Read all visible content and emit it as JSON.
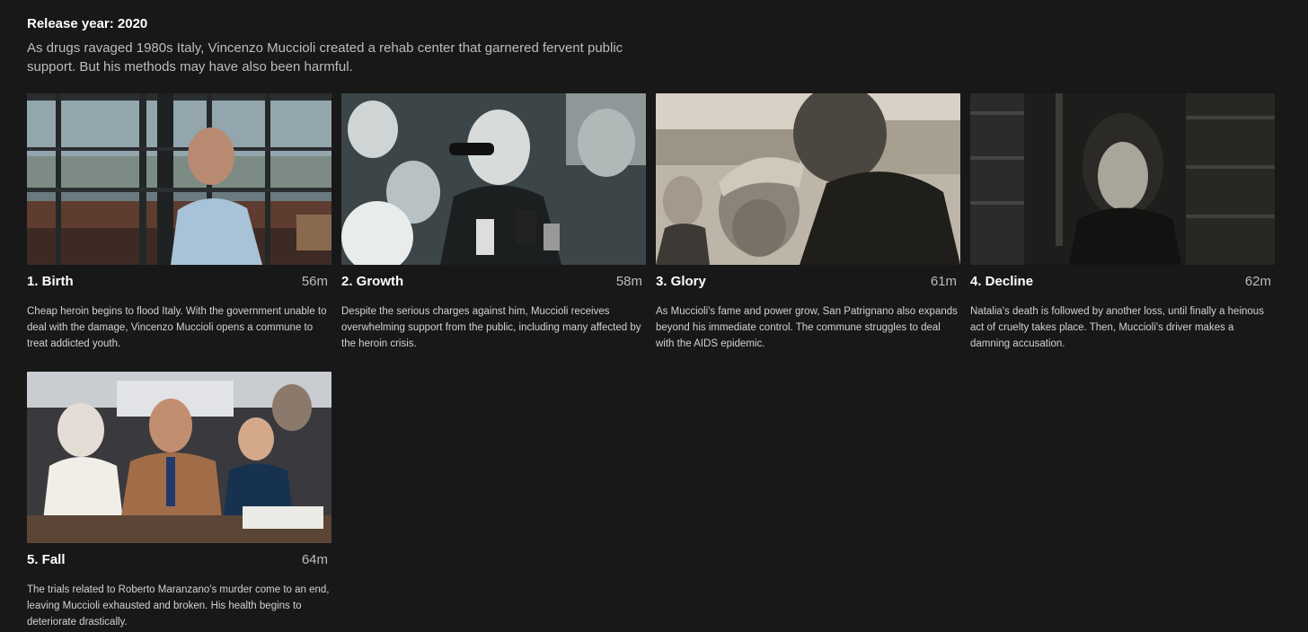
{
  "header": {
    "release_label": "Release year: 2020",
    "synopsis": "As drugs ravaged 1980s Italy, Vincenzo Muccioli created a rehab center that garnered fervent public support. But his methods may have also been harmful."
  },
  "episodes": [
    {
      "title": "1. Birth",
      "duration": "56m",
      "description": "Cheap heroin begins to flood Italy. With the government unable to deal with the damage, Vincenzo Muccioli opens a commune to treat addicted youth."
    },
    {
      "title": "2. Growth",
      "duration": "58m",
      "description": "Despite the serious charges against him, Muccioli receives overwhelming support from the public, including many affected by the heroin crisis."
    },
    {
      "title": "3. Glory",
      "duration": "61m",
      "description": "As Muccioli's fame and power grow, San Patrignano also expands beyond his immediate control. The commune struggles to deal with the AIDS epidemic."
    },
    {
      "title": "4. Decline",
      "duration": "62m",
      "description": "Natalia's death is followed by another loss, until finally a heinous act of cruelty takes place. Then, Muccioli's driver makes a damning accusation."
    },
    {
      "title": "5. Fall",
      "duration": "64m",
      "description": "The trials related to Roberto Maranzano's murder come to an end, leaving Muccioli exhausted and broken. His health begins to deteriorate drastically."
    }
  ]
}
